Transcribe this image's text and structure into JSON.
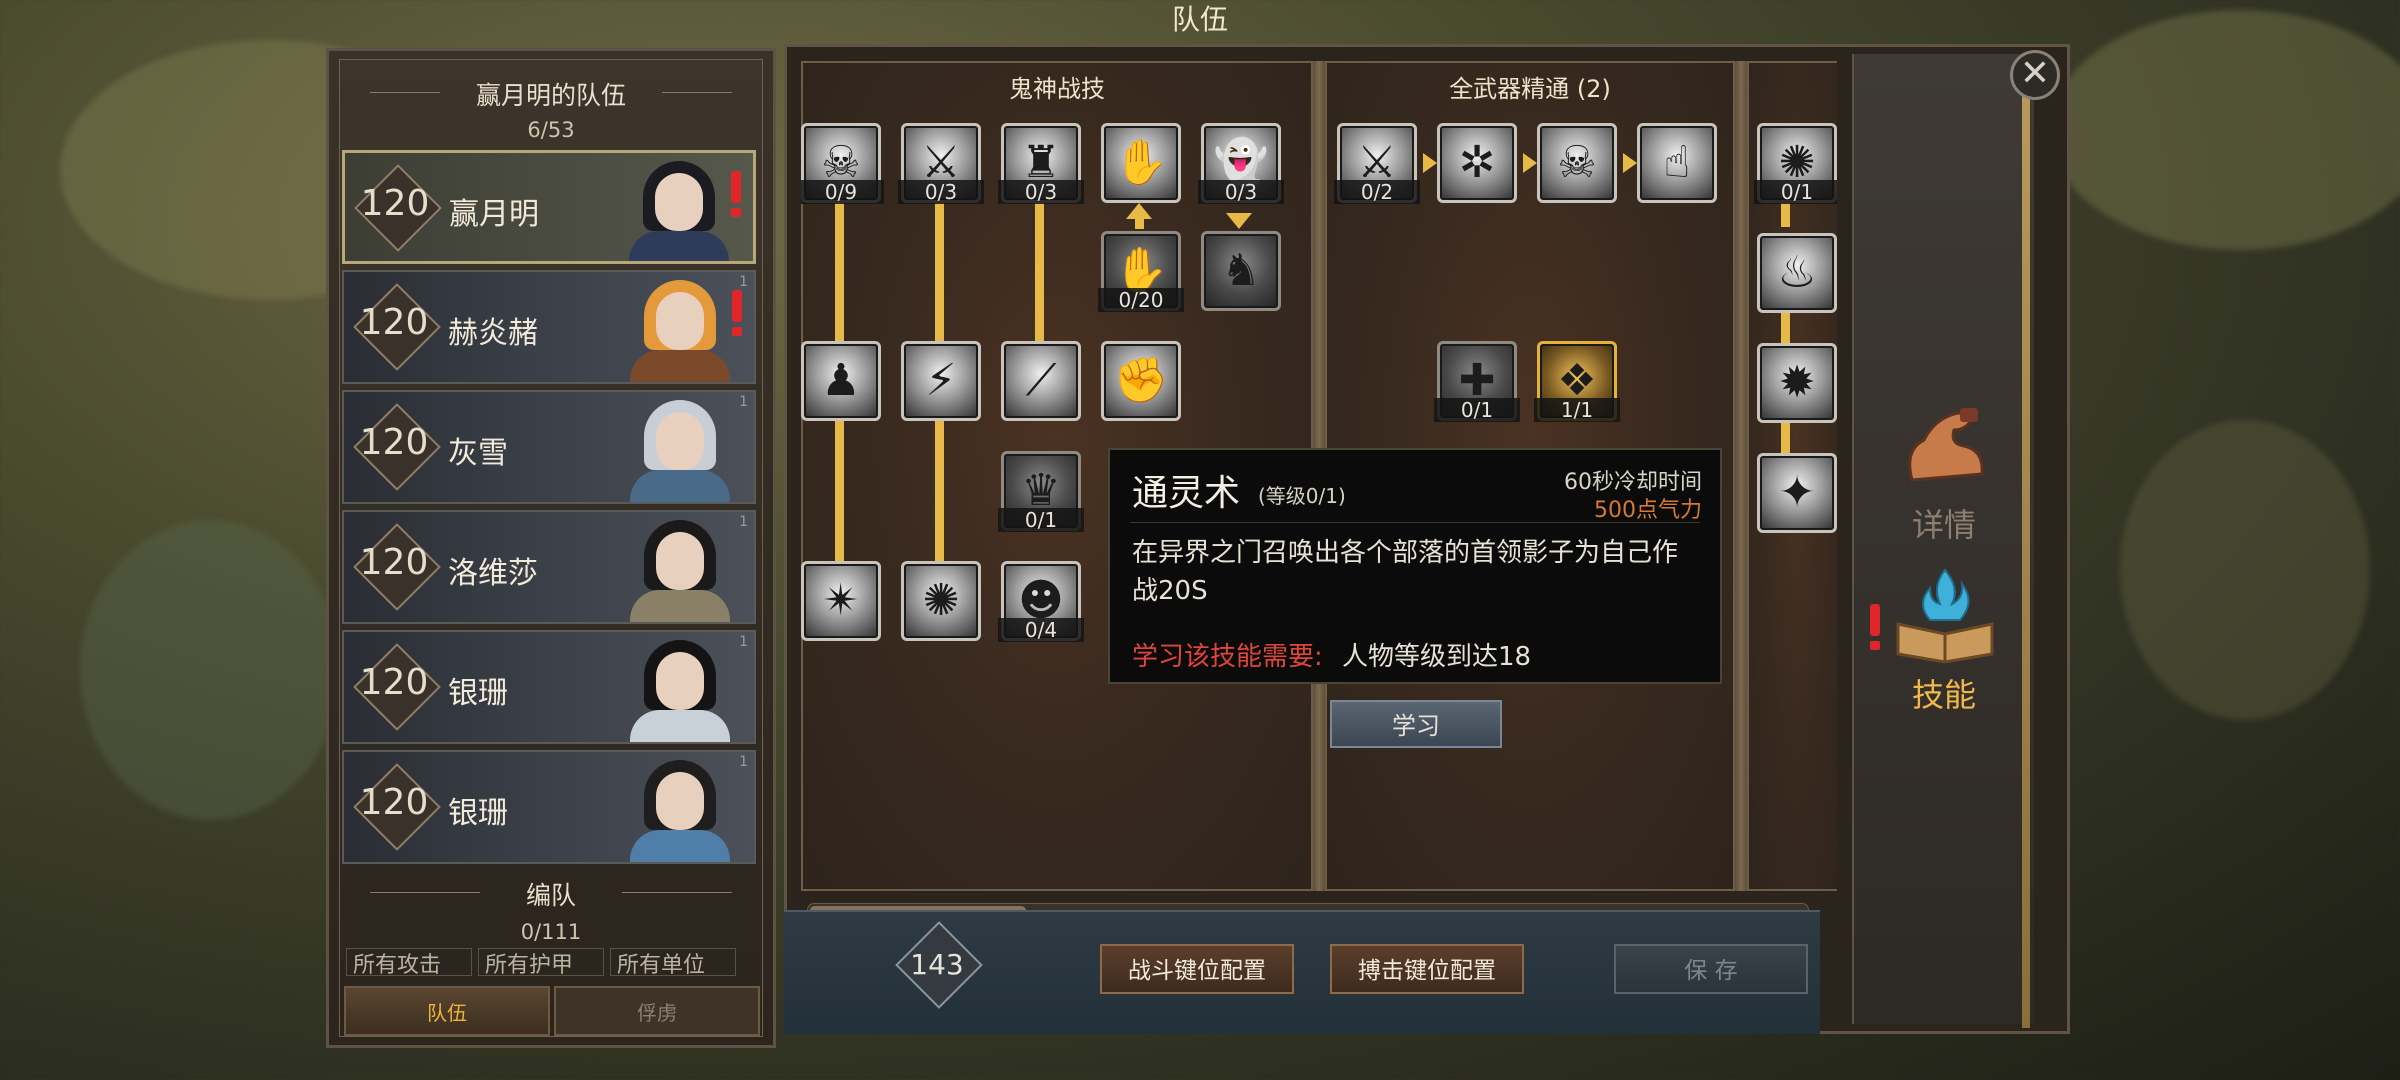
{
  "window": {
    "title": "队伍",
    "close_symbol": "✕"
  },
  "roster": {
    "title": "赢月明的队伍",
    "count": "6/53",
    "characters": [
      {
        "level": "120",
        "name": "赢月明",
        "alert": true,
        "selected": true
      },
      {
        "level": "120",
        "name": "赫炎赭",
        "alert": true,
        "corner": "1"
      },
      {
        "level": "120",
        "name": "灰雪",
        "alert": false,
        "corner": "1"
      },
      {
        "level": "120",
        "name": "洛维莎",
        "alert": false,
        "corner": "1"
      },
      {
        "level": "120",
        "name": "银珊",
        "alert": false,
        "corner": "1"
      },
      {
        "level": "120",
        "name": "银珊",
        "alert": false,
        "corner": "1"
      }
    ],
    "formation": {
      "title": "编队",
      "count": "0/111"
    },
    "filters": [
      "所有攻击",
      "所有护甲",
      "所有单位"
    ],
    "tabs": [
      {
        "label": "队伍",
        "active": true
      },
      {
        "label": "俘虏",
        "active": false
      }
    ]
  },
  "skill_trees": {
    "trees": [
      {
        "name": "鬼神战技"
      },
      {
        "name": "全武器精通 (2)"
      }
    ],
    "skills": {
      "a1": "0/9",
      "a2": "0/3",
      "a3": "0/3",
      "a5": "0/3",
      "a6": "0/20",
      "a7": "0/1",
      "a8": "0/4",
      "b1": "0/2",
      "b2": "0/1",
      "b3": "1/1",
      "c1": "0/1"
    }
  },
  "tooltip": {
    "name": "通灵术",
    "level": "(等级0/1)",
    "cooldown": "60秒冷却时间",
    "cost": "500点气力",
    "description": "在异界之门召唤出各个部落的首领影子为自己作战20S",
    "requirement_label": "学习该技能需要:",
    "requirement_value": "人物等级到达18"
  },
  "learn_button": "学习",
  "bottom_bar": {
    "points": "143",
    "combat_keys": "战斗键位配置",
    "grapple_keys": "搏击键位配置",
    "save": "保 存"
  },
  "side_tabs": [
    {
      "label": "详情",
      "icon": "flexed-arm-icon"
    },
    {
      "label": "技能",
      "icon": "flame-book-icon",
      "alert": true
    }
  ],
  "colors": {
    "accent_gold": "#e7b947",
    "cost_orange": "#d57a34",
    "requirement_red": "#e0453a",
    "active_tab": "#f0b23a",
    "alert_red": "#e0262a"
  }
}
